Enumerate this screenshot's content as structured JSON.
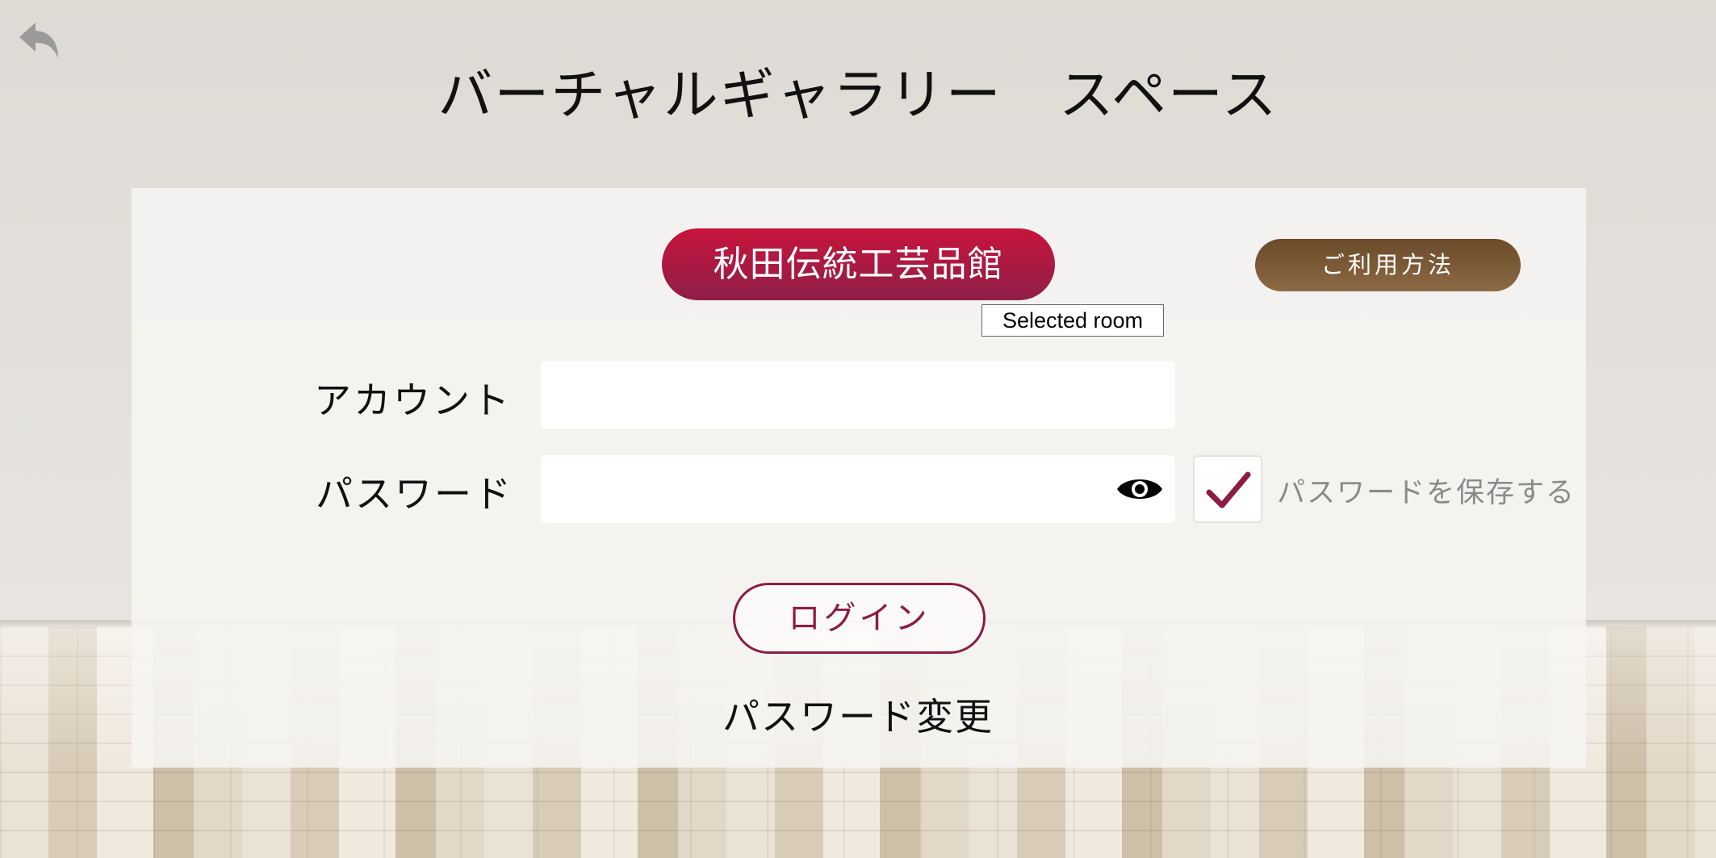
{
  "header": {
    "title": "バーチャルギャラリー　スペース",
    "back_icon": "undo-arrow-icon"
  },
  "room": {
    "selected_label": "秋田伝統工芸品館",
    "tooltip": "Selected room",
    "color_top": "#c8143c",
    "color_bottom": "#8e1f48"
  },
  "usage_button": {
    "label": "ご利用方法",
    "color": "#7a5836"
  },
  "form": {
    "account_label": "アカウント",
    "account_value": "",
    "password_label": "パスワード",
    "password_value": "",
    "password_visibility_icon": "eye-icon",
    "save_password_checked": true,
    "save_password_label": "パスワードを保存する",
    "check_icon": "checkmark-icon",
    "check_color": "#8b1d44"
  },
  "actions": {
    "login_label": "ログイン",
    "password_change_label": "パスワード変更",
    "accent_color": "#8b1d44"
  }
}
